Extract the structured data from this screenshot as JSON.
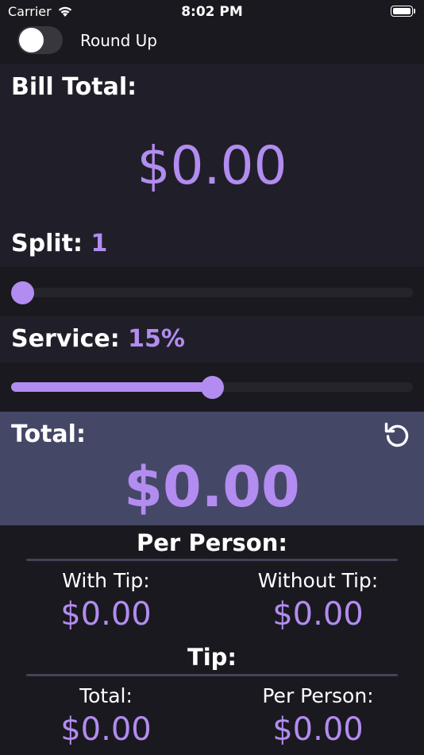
{
  "status_bar": {
    "carrier": "Carrier",
    "time": "8:02 PM"
  },
  "round_up": {
    "label": "Round Up",
    "enabled": false
  },
  "bill": {
    "title": "Bill Total:",
    "amount": "$0.00"
  },
  "split": {
    "label": "Split:",
    "value": "1",
    "slider_fraction": 0.0
  },
  "service": {
    "label": "Service:",
    "value": "15%",
    "slider_fraction": 0.5
  },
  "total": {
    "title": "Total:",
    "amount": "$0.00",
    "reset_icon": "reset-icon"
  },
  "per_person": {
    "title": "Per Person:",
    "with_tip_label": "With Tip:",
    "with_tip_value": "$0.00",
    "without_tip_label": "Without Tip:",
    "without_tip_value": "$0.00"
  },
  "tip": {
    "title": "Tip:",
    "total_label": "Total:",
    "total_value": "$0.00",
    "per_person_label": "Per Person:",
    "per_person_value": "$0.00"
  },
  "colors": {
    "accent": "#b28cf0",
    "background": "#1a191f",
    "panel": "#201f29",
    "total_panel": "#454767"
  }
}
